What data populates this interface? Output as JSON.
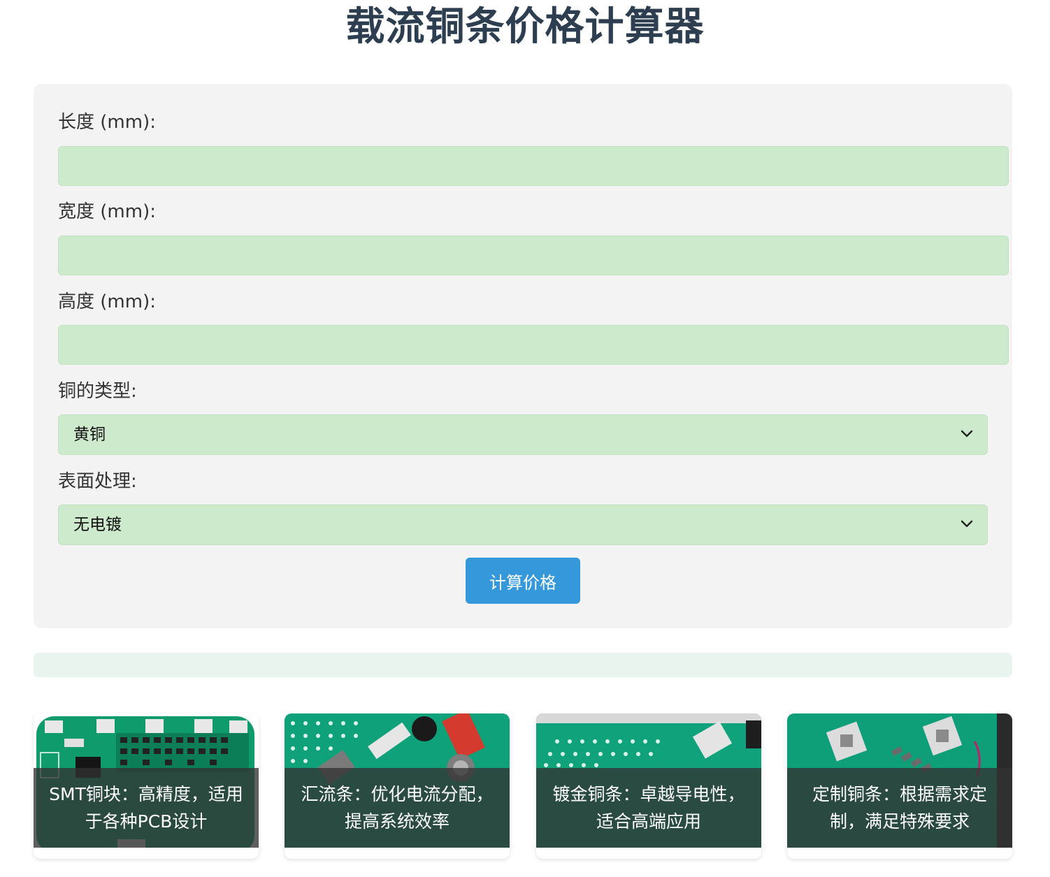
{
  "header": {
    "title": "载流铜条价格计算器"
  },
  "form": {
    "length_label": "长度 (mm):",
    "length_value": "",
    "width_label": "宽度 (mm):",
    "width_value": "",
    "height_label": "高度 (mm):",
    "height_value": "",
    "copper_type_label": "铜的类型:",
    "copper_type_selected": "黄铜",
    "surface_label": "表面处理:",
    "surface_selected": "无电镀",
    "calculate_label": "计算价格"
  },
  "result": {
    "text": ""
  },
  "products": [
    {
      "caption": "SMT铜块：高精度，适用于各种PCB设计",
      "image": "pcb-board-photo"
    },
    {
      "caption": "汇流条：优化电流分配，提高系统效率",
      "image": "busbar-photo"
    },
    {
      "caption": "镀金铜条：卓越导电性，适合高端应用",
      "image": "gold-plated-copper-photo"
    },
    {
      "caption": "定制铜条：根据需求定制，满足特殊要求",
      "image": "custom-copper-photo"
    }
  ],
  "colors": {
    "title": "#2c3e50",
    "input_bg": "#cdeacd",
    "card_bg": "#f3f3f3",
    "button_bg": "#3498db",
    "result_bg": "#e9f4ef",
    "pcb_green": "#0fa27a"
  }
}
